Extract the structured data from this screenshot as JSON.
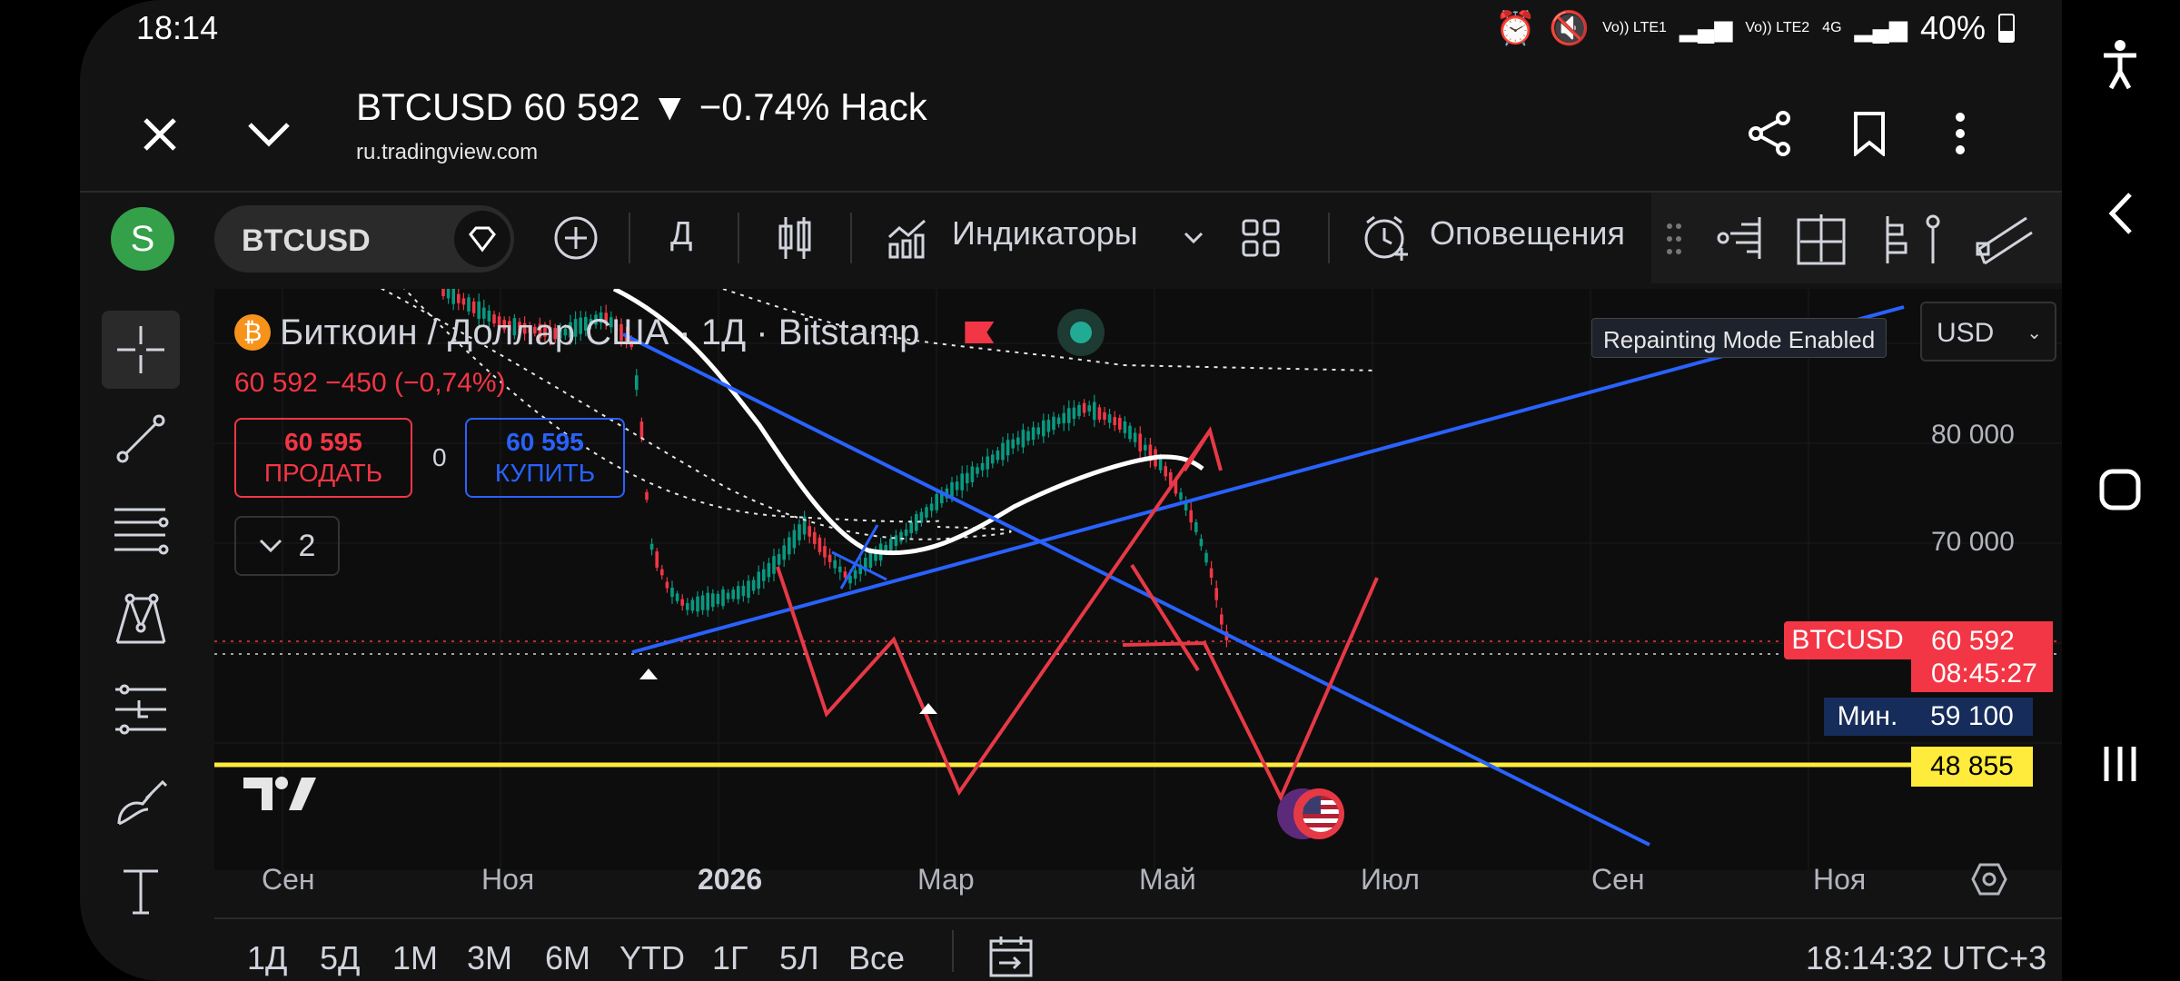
{
  "status": {
    "time": "18:14",
    "lte1": "Vo)) LTE1",
    "lte2": "Vo)) LTE2",
    "net": "4G",
    "battery": "40%"
  },
  "browser": {
    "title": "BTCUSD 60 592 ▼ −0.74% Hack",
    "url": "ru.tradingview.com"
  },
  "toolbar": {
    "avatar": "S",
    "symbol": "BTCUSD",
    "interval": "Д",
    "indicators": "Индикаторы",
    "alerts": "Оповещения"
  },
  "legend": {
    "title": "Биткоин / Доллар США · 1Д · Bitstamp",
    "price_line": "60 592  −450 (−0,74%)",
    "sell_price": "60 595",
    "sell_label": "ПРОДАТЬ",
    "spread": "0",
    "buy_price": "60 595",
    "buy_label": "КУПИТЬ",
    "collapse_count": "2"
  },
  "tooltip": "Repainting Mode Enabled",
  "currency": "USD",
  "price_axis": [
    "80 000",
    "70 000"
  ],
  "tags": {
    "symbol": "BTCUSD",
    "last": "60 592",
    "countdown": "08:45:27",
    "min_label": "Мин.",
    "min_value": "59 100",
    "level_value": "48 855"
  },
  "time_axis": [
    "Сен",
    "Ноя",
    "2026",
    "Мар",
    "Май",
    "Июл",
    "Сен",
    "Ноя"
  ],
  "ranges": [
    "1Д",
    "5Д",
    "1М",
    "3М",
    "6М",
    "YTD",
    "1Г",
    "5Л",
    "Все"
  ],
  "clock": "18:14:32 UTC+3",
  "colors": {
    "up": "#089981",
    "down": "#f23645",
    "blue_line": "#2962ff",
    "yellow_line": "#ffeb3b",
    "red_drawing": "#e63946"
  }
}
